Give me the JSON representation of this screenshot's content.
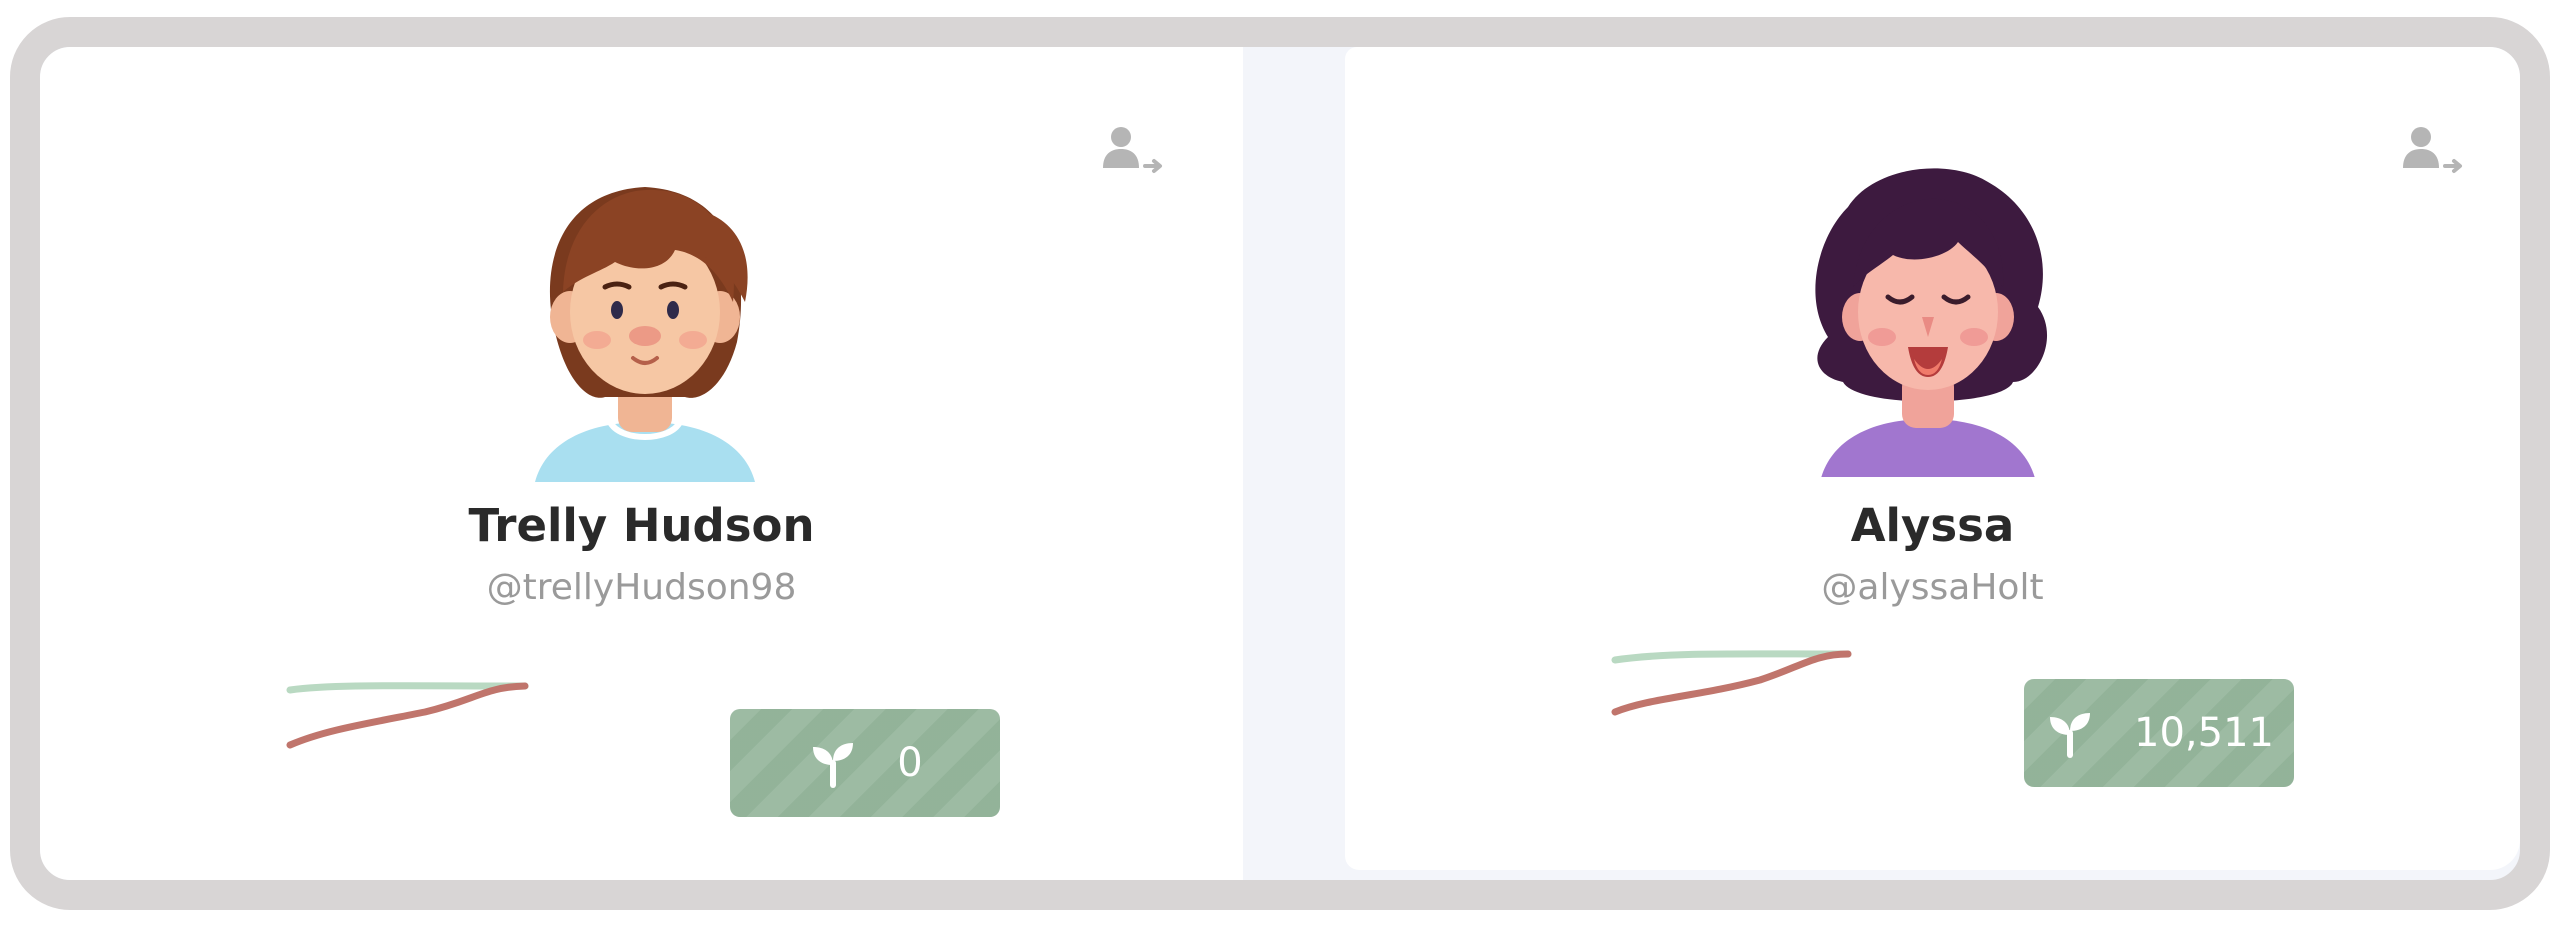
{
  "profiles": [
    {
      "name": "Trelly Hudson",
      "handle": "@trellyHudson98",
      "points": "0",
      "avatar_icon": "boy-avatar",
      "leave_icon": "person-arrow-icon"
    },
    {
      "name": "Alyssa",
      "handle": "@alyssaHolt",
      "points": "10,511",
      "avatar_icon": "girl-avatar",
      "leave_icon": "person-arrow-icon"
    }
  ],
  "colors": {
    "frame": "#d8d5d5",
    "badge": "#9dbba3",
    "sparkline_red": "#c0756c",
    "sparkline_green": "#b9d9c2",
    "text_dark": "#2a2a2a",
    "text_muted": "#9a9a9a"
  }
}
